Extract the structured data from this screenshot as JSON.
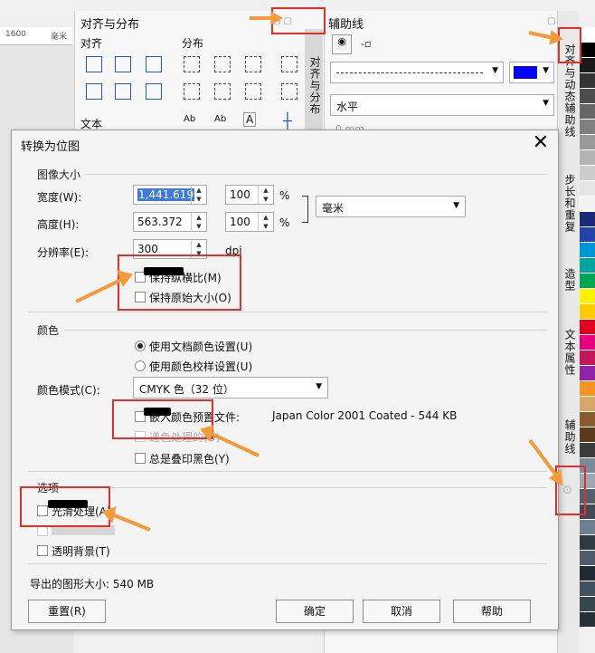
{
  "ruler": {
    "tick_1600": "1600",
    "unit": "毫米"
  },
  "align_panel": {
    "title": "对齐与分布",
    "align_label": "对齐",
    "distribute_label": "分布",
    "text_label": "文本",
    "vertical_tab": "对齐与分布"
  },
  "guide_panel": {
    "title": "辅助线",
    "orientation_value": "水平",
    "partial_value": "0 mm",
    "line_color": "#0000ff"
  },
  "dock_tabs": [
    "对齐与动态辅助线",
    "步长和重复",
    "造型",
    "文本属性",
    "辅助线"
  ],
  "palette_colors": [
    "#ffffff",
    "#000000",
    "#1a1a1a",
    "#333333",
    "#4d4d4d",
    "#666666",
    "#808080",
    "#999999",
    "#b3b3b3",
    "#cccccc",
    "#e6e6e6",
    "#f2f2f2",
    "#1e2a78",
    "#2244aa",
    "#0096d6",
    "#00a3a0",
    "#00a651",
    "#fff200",
    "#ffcb05",
    "#e2001a",
    "#e4007f",
    "#c2185b",
    "#8e24aa",
    "#f7941d",
    "#d8a86a",
    "#8b5a2b",
    "#5a3a1a",
    "#3c3c3c",
    "#7a8a99",
    "#9aa8b5",
    "#55606e",
    "#3f4a56",
    "#6f7f8f",
    "#2f3a45",
    "#4f5b67",
    "#1f2a35",
    "#425060",
    "#37474f",
    "#263238"
  ],
  "dialog": {
    "title": "转换为位图",
    "image_size": {
      "group": "图像大小",
      "width_label": "宽度(W):",
      "width_value": "1,441.619",
      "width_pct": "100",
      "height_label": "高度(H):",
      "height_value": "563.372",
      "height_pct": "100",
      "pct_unit": "%",
      "unit_value": "毫米",
      "resolution_label": "分辨率(E):",
      "resolution_value": "300",
      "resolution_unit": "dpi",
      "keep_ratio": "保持纵横比(M)",
      "keep_original": "保持原始大小(O)"
    },
    "color": {
      "group": "颜色",
      "use_doc": "使用文档颜色设置(U)",
      "use_proof": "使用颜色校样设置(U)",
      "mode_label": "颜色模式(C):",
      "mode_value": "CMYK 色（32 位）",
      "embed_profile": "嵌入颜色预置文件:",
      "profile_name": "Japan Color 2001 Coated - 544 KB",
      "dither": "递色处理的(D)",
      "overprint_black": "总是叠印黑色(Y)"
    },
    "options": {
      "group": "选项",
      "anti_alias": "光滑处理(A)",
      "transparent_bg": "透明背景(T)"
    },
    "export_size": "导出的图形大小: 540 MB",
    "buttons": {
      "reset": "重置(R)",
      "ok": "确定",
      "cancel": "取消",
      "help": "帮助"
    }
  }
}
